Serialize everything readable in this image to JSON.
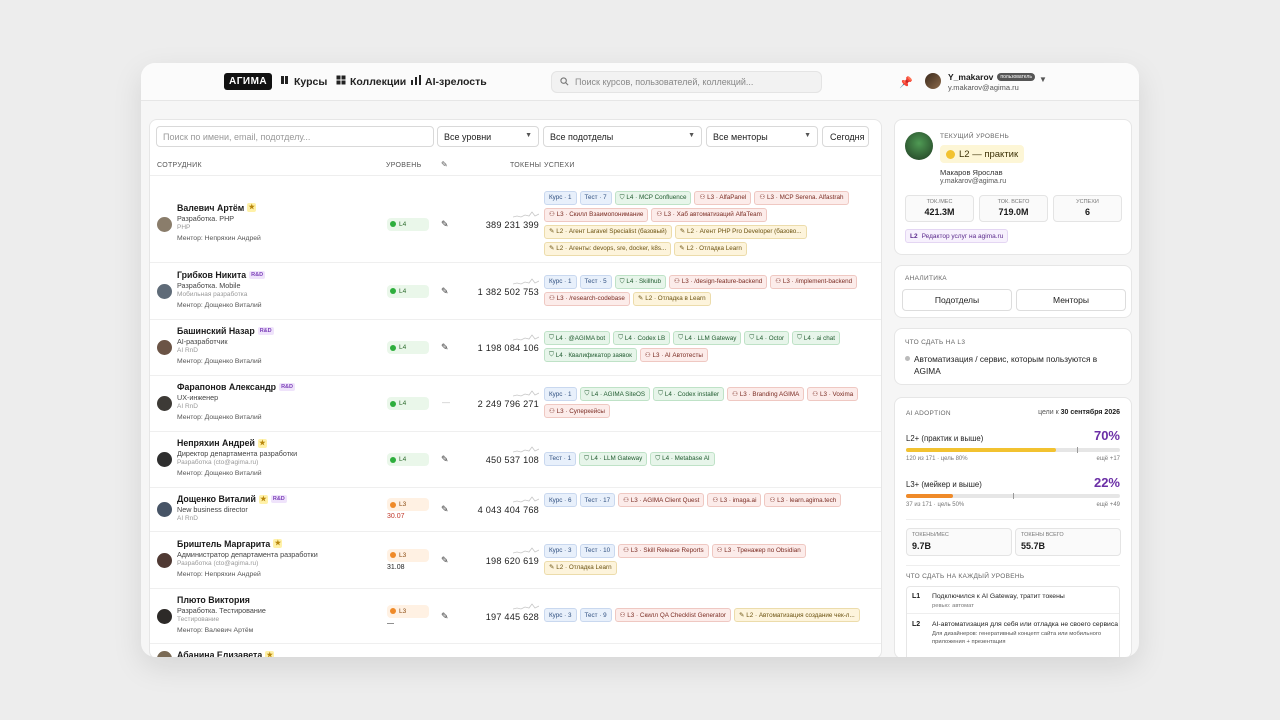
{
  "header": {
    "logo": "АГИМА",
    "nav": [
      {
        "label": "Курсы",
        "icon": "book-icon"
      },
      {
        "label": "Коллекции",
        "icon": "grid-icon"
      },
      {
        "label": "AI-зрелость",
        "icon": "bar-chart-icon"
      }
    ],
    "search_placeholder": "Поиск курсов, пользователей, коллекций...",
    "user": {
      "name": "Y_makarov",
      "badge": "пользователь",
      "email": "y.makarov@agima.ru"
    }
  },
  "filters": {
    "search_placeholder": "Поиск по имени, email, подотделу...",
    "level": "Все уровни",
    "subdept": "Все подотделы",
    "mentor": "Все менторы",
    "period_button": "Сегодня"
  },
  "table": {
    "headers": {
      "employee": "СОТРУДНИК",
      "level": "УРОВЕНЬ",
      "tokens": "ТОКЕНЫ",
      "success": "УСПЕХИ"
    },
    "rows": [
      {
        "name": "Валевич Артём",
        "star": "★",
        "rnd": "",
        "role": "Разработка. PHP",
        "dept": "PHP",
        "mentor": "Ментор: Непряхин Андрей",
        "level": "L4",
        "sub": "",
        "pen": "✎",
        "tokens": "389 231 399",
        "chips": [
          [
            "Курс · 1",
            "blue"
          ],
          [
            "Тест · 7",
            "blue"
          ],
          [
            "L4 · MCP Confluence",
            "green"
          ],
          [
            "L3 · AlfaPanel",
            "red"
          ],
          [
            "L3 · MCP Serena. Alfastrah",
            "red"
          ],
          [
            "L3 · Скилл Взаимопонимание",
            "red"
          ],
          [
            "L3 · Хаб автоматизаций AlfaTeam",
            "red"
          ],
          [
            "L2 · Агент Laravel Specialist (базовый)",
            "yellow"
          ],
          [
            "L2 · Агент PHP Pro Developer (базово...",
            "yellow"
          ],
          [
            "L2 · Агенты: devops, sre, docker, k8s...",
            "yellow"
          ],
          [
            "L2 · Отладка Learn",
            "yellow"
          ]
        ]
      },
      {
        "name": "Грибков Никита",
        "star": "",
        "rnd": "R&D",
        "role": "Разработка. Mobile",
        "dept": "Мобильная разработка",
        "mentor": "Ментор: Дощенко Виталий",
        "level": "L4",
        "sub": "",
        "pen": "✎",
        "tokens": "1 382 502 753",
        "chips": [
          [
            "Курс · 1",
            "blue"
          ],
          [
            "Тест · 5",
            "blue"
          ],
          [
            "L4 · Skillhub",
            "green"
          ],
          [
            "L3 · /design-feature-backend",
            "red"
          ],
          [
            "L3 · /implement-backend",
            "red"
          ],
          [
            "L3 · /research-codebase",
            "red"
          ],
          [
            "L2 · Отладка в Learn",
            "yellow"
          ]
        ]
      },
      {
        "name": "Башинский Назар",
        "star": "",
        "rnd": "R&D",
        "role": "AI-разработчик",
        "dept": "AI RnD",
        "mentor": "Ментор: Дощенко Виталий",
        "level": "L4",
        "sub": "",
        "pen": "✎",
        "tokens": "1 198 084 106",
        "chips": [
          [
            "L4 · @AGIMA bot",
            "green"
          ],
          [
            "L4 · Codex LB",
            "green"
          ],
          [
            "L4 · LLM Gateway",
            "green"
          ],
          [
            "L4 · Octor",
            "green"
          ],
          [
            "L4 · ai chat",
            "green"
          ],
          [
            "L4 · Квалификатор заявок",
            "green"
          ],
          [
            "L3 · AI Автотесты",
            "red"
          ]
        ]
      },
      {
        "name": "Фарапонов Александр",
        "star": "",
        "rnd": "R&D",
        "role": "UX-инженер",
        "dept": "AI RnD",
        "mentor": "Ментор: Дощенко Виталий",
        "level": "L4",
        "sub": "",
        "pen": "—",
        "tokens": "2 249 796 271",
        "chips": [
          [
            "Курс · 1",
            "blue"
          ],
          [
            "L4 · AGIMA SiteOS",
            "green"
          ],
          [
            "L4 · Codex installer",
            "green"
          ],
          [
            "L3 · Branding AGIMA",
            "red"
          ],
          [
            "L3 · Voxima",
            "red"
          ],
          [
            "L3 · Суперкейсы",
            "red"
          ]
        ]
      },
      {
        "name": "Непряхин Андрей",
        "star": "★",
        "rnd": "",
        "role": "Директор департамента разработки",
        "dept": "Разработка (cto@agima.ru)",
        "mentor": "Ментор: Дощенко Виталий",
        "level": "L4",
        "sub": "",
        "pen": "✎",
        "tokens": "450 537 108",
        "chips": [
          [
            "Тест · 1",
            "blue"
          ],
          [
            "L4 · LLM Gateway",
            "green"
          ],
          [
            "L4 · Metabase AI",
            "green"
          ]
        ]
      },
      {
        "name": "Дощенко Виталий",
        "star": "★",
        "rnd": "R&D",
        "role": "New business director",
        "dept": "AI RnD",
        "mentor": "",
        "level": "L3",
        "sub": "30.07",
        "pen": "✎",
        "tokens": "4 043 404 768",
        "chips": [
          [
            "Курс · 6",
            "blue"
          ],
          [
            "Тест · 17",
            "blue"
          ],
          [
            "L3 · AGIMA Client Quest",
            "red"
          ],
          [
            "L3 · imaga.ai",
            "red"
          ],
          [
            "L3 · learn.agima.tech",
            "red"
          ]
        ]
      },
      {
        "name": "Бриштель Маргарита",
        "star": "★",
        "rnd": "",
        "role": "Администратор департамента разработки",
        "dept": "Разработка (cto@agima.ru)",
        "mentor": "Ментор: Непряхин Андрей",
        "level": "L3",
        "sub": "31.08",
        "pen": "✎",
        "tokens": "198 620 619",
        "chips": [
          [
            "Курс · 3",
            "blue"
          ],
          [
            "Тест · 10",
            "blue"
          ],
          [
            "L3 · Skill Release Reports",
            "red"
          ],
          [
            "L3 · Тренажер по Obsidian",
            "red"
          ],
          [
            "L2 · Отладка Learn",
            "yellow"
          ]
        ]
      },
      {
        "name": "Плюто Виктория",
        "star": "",
        "rnd": "",
        "role": "Разработка. Тестирование",
        "dept": "Тестирование",
        "mentor": "Ментор: Валевич Артём",
        "level": "L3",
        "sub": "—",
        "pen": "✎",
        "tokens": "197 445 628",
        "chips": [
          [
            "Курс · 3",
            "blue"
          ],
          [
            "Тест · 9",
            "blue"
          ],
          [
            "L3 · Скилл QA Checklist Generator",
            "red"
          ],
          [
            "L2 · Автоматизация создание чек-л...",
            "yellow"
          ]
        ]
      },
      {
        "name": "Абанина Елизавета",
        "star": "★",
        "rnd": "",
        "role": "",
        "dept": "",
        "mentor": "",
        "level": "",
        "sub": "",
        "pen": "",
        "tokens": "",
        "chips": []
      }
    ]
  },
  "current_level": {
    "label": "ТЕКУЩИЙ УРОВЕНЬ",
    "level": "L2 — практик",
    "name": "Макаров Ярослав",
    "email": "y.makarov@agima.ru",
    "stats": [
      {
        "label": "ТОК./МЕС",
        "value": "421.3M"
      },
      {
        "label": "ТОК. ВСЕГО",
        "value": "719.0M"
      },
      {
        "label": "УСПЕХИ",
        "value": "6"
      }
    ],
    "tag_level": "L2",
    "tag_label": "Редактор услуг на agima.ru"
  },
  "analytics": {
    "label": "АНАЛИТИКА",
    "btn1": "Подотделы",
    "btn2": "Менторы"
  },
  "next_level": {
    "label": "ЧТО СДАТЬ НА L3",
    "item": "Автоматизация / сервис, которым пользуются в AGIMA"
  },
  "adoption": {
    "label": "AI ADOPTION",
    "goal_prefix": "цели к",
    "goal_date": "30 сентября 2026",
    "l2": {
      "label": "L2+ (практик и выше)",
      "pct": "70%",
      "fill": 0.7,
      "goal": 0.8,
      "left": "120 из 171 · цель 80%",
      "right": "ещё +17"
    },
    "l3": {
      "label": "L3+ (мейкер и выше)",
      "pct": "22%",
      "fill": 0.22,
      "goal": 0.5,
      "left": "37 из 171 · цель 50%",
      "right": "ещё +49"
    },
    "tiles": [
      {
        "label": "ТОКЕНЫ/МЕС",
        "value": "9.7B"
      },
      {
        "label": "ТОКЕНЫ ВСЕГО",
        "value": "55.7B"
      }
    ],
    "each_label": "ЧТО СДАТЬ НА КАЖДЫЙ УРОВЕНЬ",
    "levels": [
      {
        "lvl": "L1",
        "title": "Подключился к AI Gateway, тратит токены",
        "desc": "ревью: автомат",
        "desc2": ""
      },
      {
        "lvl": "L2",
        "title": "AI-автоматизация для себя или отладка не своего сервиса",
        "desc": "Для дизайнеров: генеративный концепт сайта или мобильного",
        "desc2": "приложения + презентация"
      }
    ]
  },
  "colors": {
    "accent_green": "#2eae3d",
    "accent_orange": "#ef8a29",
    "accent_yellow": "#f2c230",
    "purple_pct": "#6b2fa6"
  }
}
